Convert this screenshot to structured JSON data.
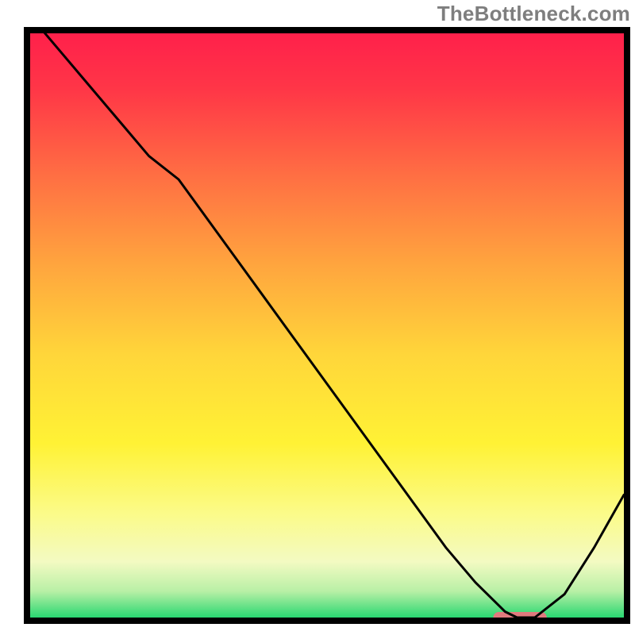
{
  "watermark": "TheBottleneck.com",
  "chart_data": {
    "type": "line",
    "title": "",
    "xlabel": "",
    "ylabel": "",
    "xlim": [
      0,
      100
    ],
    "ylim": [
      0,
      100
    ],
    "x": [
      0,
      5,
      10,
      15,
      20,
      25,
      30,
      35,
      40,
      45,
      50,
      55,
      60,
      65,
      70,
      75,
      80,
      82,
      85,
      90,
      95,
      100
    ],
    "values": [
      103,
      97,
      91,
      85,
      79,
      75,
      68,
      61,
      54,
      47,
      40,
      33,
      26,
      19,
      12,
      6,
      1,
      0,
      0,
      4,
      12,
      21
    ],
    "grid": false,
    "legend": false,
    "marker": {
      "x_start": 78,
      "x_end": 87,
      "y": 0,
      "color": "#e07a7e"
    },
    "gradient_stops": [
      {
        "offset": 0.0,
        "color": "#ff1f4b"
      },
      {
        "offset": 0.1,
        "color": "#ff3647"
      },
      {
        "offset": 0.25,
        "color": "#ff7043"
      },
      {
        "offset": 0.4,
        "color": "#ffa63e"
      },
      {
        "offset": 0.55,
        "color": "#ffd63a"
      },
      {
        "offset": 0.7,
        "color": "#fff235"
      },
      {
        "offset": 0.82,
        "color": "#fbfb8a"
      },
      {
        "offset": 0.9,
        "color": "#f3fac2"
      },
      {
        "offset": 0.95,
        "color": "#b9f0a6"
      },
      {
        "offset": 1.0,
        "color": "#18d46b"
      }
    ],
    "axis_thickness_px": 8
  }
}
